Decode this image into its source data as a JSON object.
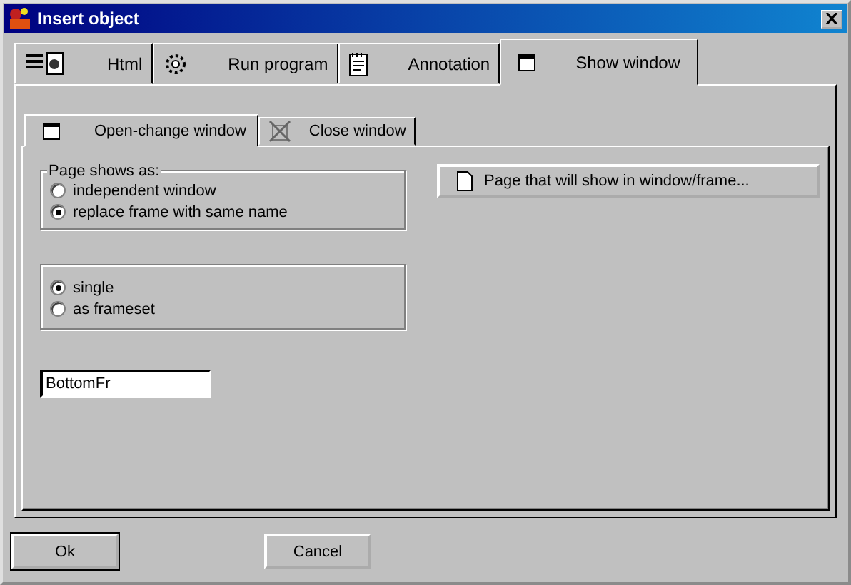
{
  "window": {
    "title": "Insert object"
  },
  "tabs": [
    {
      "label": "Html",
      "selected": false,
      "kind": "html"
    },
    {
      "label": "Run program",
      "selected": false,
      "kind": "gear"
    },
    {
      "label": "Annotation",
      "selected": false,
      "kind": "note"
    },
    {
      "label": "Show window",
      "selected": true,
      "kind": "window"
    }
  ],
  "subtabs": [
    {
      "label": "Open-change window",
      "selected": true,
      "kind": "window"
    },
    {
      "label": "Close window",
      "selected": false,
      "kind": "close"
    }
  ],
  "page_group": {
    "title": "Page shows as:",
    "options": [
      {
        "label": "independent window",
        "selected": false
      },
      {
        "label": "replace frame with same name",
        "selected": true
      }
    ]
  },
  "layout_group": {
    "options": [
      {
        "label": "single",
        "selected": true
      },
      {
        "label": "as frameset",
        "selected": false
      }
    ]
  },
  "frame_name_field": {
    "value": "BottomFr"
  },
  "page_button": {
    "label": "Page that will show in window/frame..."
  },
  "buttons": [
    {
      "label": "Ok"
    },
    {
      "label": "Cancel"
    }
  ]
}
